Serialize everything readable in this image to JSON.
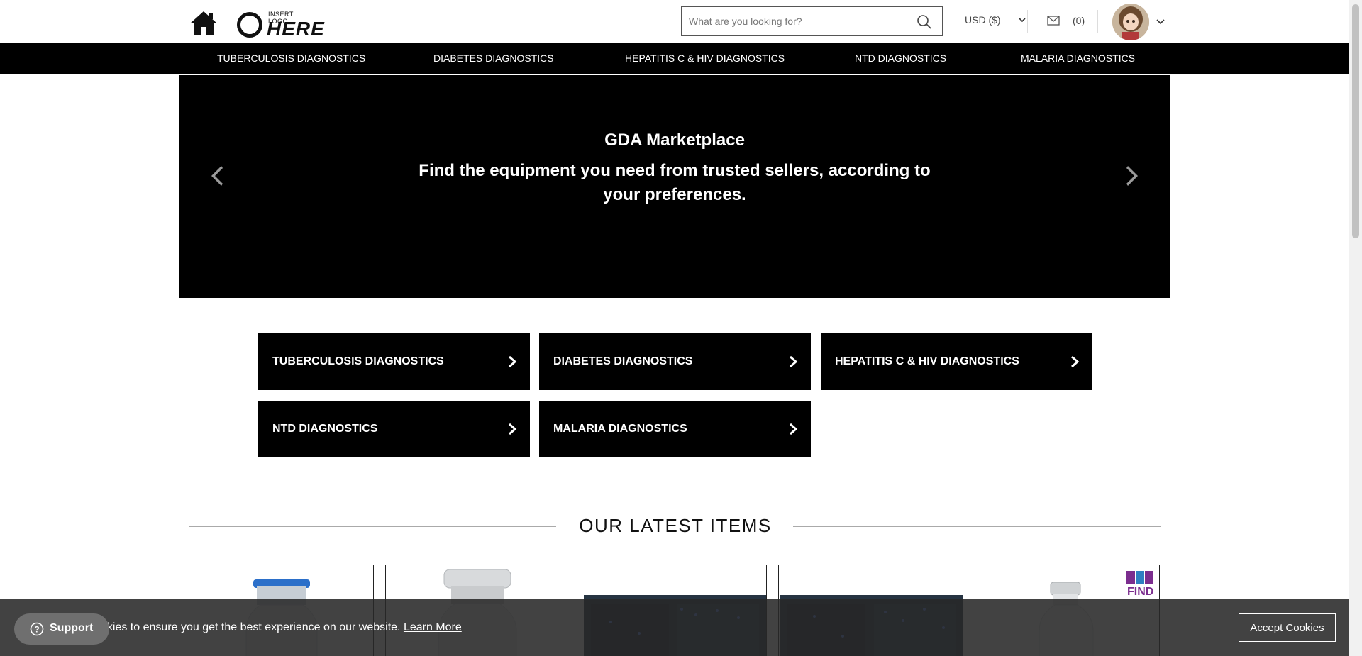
{
  "header": {
    "logo": {
      "small_text": "INSERT LOGO",
      "big_text": "HERE"
    },
    "search": {
      "placeholder": "What are you looking for?",
      "value": ""
    },
    "currency": "USD ($)",
    "messages_count": "(0)"
  },
  "nav": {
    "items": [
      "TUBERCULOSIS DIAGNOSTICS",
      "DIABETES DIAGNOSTICS",
      "HEPATITIS C & HIV DIAGNOSTICS",
      "NTD DIAGNOSTICS",
      "MALARIA DIAGNOSTICS"
    ]
  },
  "hero": {
    "title": "GDA Marketplace",
    "subtitle": "Find the equipment you need from trusted sellers, according to your preferences."
  },
  "categories": [
    "TUBERCULOSIS DIAGNOSTICS",
    "DIABETES DIAGNOSTICS",
    "HEPATITIS C & HIV DIAGNOSTICS",
    "NTD DIAGNOSTICS",
    "MALARIA DIAGNOSTICS"
  ],
  "latest": {
    "title": "OUR LATEST ITEMS",
    "cards": [
      {
        "image": "vial-blue-cap"
      },
      {
        "image": "vial-silver-cap"
      },
      {
        "image": "lab-instrument"
      },
      {
        "image": "lab-instrument"
      },
      {
        "image": "vial-clear",
        "badge": "FIND"
      }
    ]
  },
  "cookie": {
    "text": "okies to ensure you get the best experience on our website.",
    "link": "Learn More",
    "accept": "Accept Cookies"
  },
  "support": {
    "label": "Support"
  },
  "colors": {
    "nav_bg": "#000000",
    "tile_bg": "#000000",
    "cookie_bg": "#282828",
    "find_badge": "#7b2d8e"
  }
}
